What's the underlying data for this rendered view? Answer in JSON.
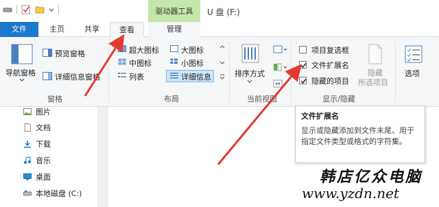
{
  "titlebar": {
    "contextual_tools": "驱动器工具",
    "window_title": "U 盘 (F:)"
  },
  "tabs": [
    {
      "label": "文件"
    },
    {
      "label": "主页"
    },
    {
      "label": "共享"
    },
    {
      "label": "查看"
    },
    {
      "label": "管理"
    }
  ],
  "ribbon": {
    "panes": {
      "nav_pane": "导航窗格",
      "preview_pane": "预览窗格",
      "details_pane": "详细信息窗格",
      "group_label": "窗格"
    },
    "layout": {
      "extra_large": "超大图标",
      "large": "大图标",
      "medium": "中图标",
      "small": "小图标",
      "list": "列表",
      "details": "详细信息",
      "group_label": "布局"
    },
    "current_view": {
      "sort_by": "排序方式",
      "group_label": "当前视图"
    },
    "show_hide": {
      "item_checkboxes": "项目复选框",
      "file_extensions": "文件扩展名",
      "hidden_items": "隐藏的项目",
      "hide_selected_line1": "隐藏",
      "hide_selected_line2": "所选项目",
      "group_label": "显示/隐藏",
      "item_checkboxes_checked": false,
      "file_extensions_checked": true,
      "hidden_items_checked": true
    },
    "options": "选项"
  },
  "nav": {
    "items": [
      {
        "label": "图片"
      },
      {
        "label": "文档"
      },
      {
        "label": "下载"
      },
      {
        "label": "音乐"
      },
      {
        "label": "桌面"
      },
      {
        "label": "本地磁盘 (C:)"
      }
    ]
  },
  "tooltip": {
    "title": "文件扩展名",
    "body": "显示或隐藏添加到文件末尾、用于指定文件类型或格式的字符集。"
  },
  "watermark": {
    "line1": "韩店亿众电脑",
    "line2": "www.yzdn.net"
  },
  "colors": {
    "file_tab": "#1979ca",
    "contextual_tab": "#c5e6a9",
    "arrow": "#e23b2e"
  }
}
